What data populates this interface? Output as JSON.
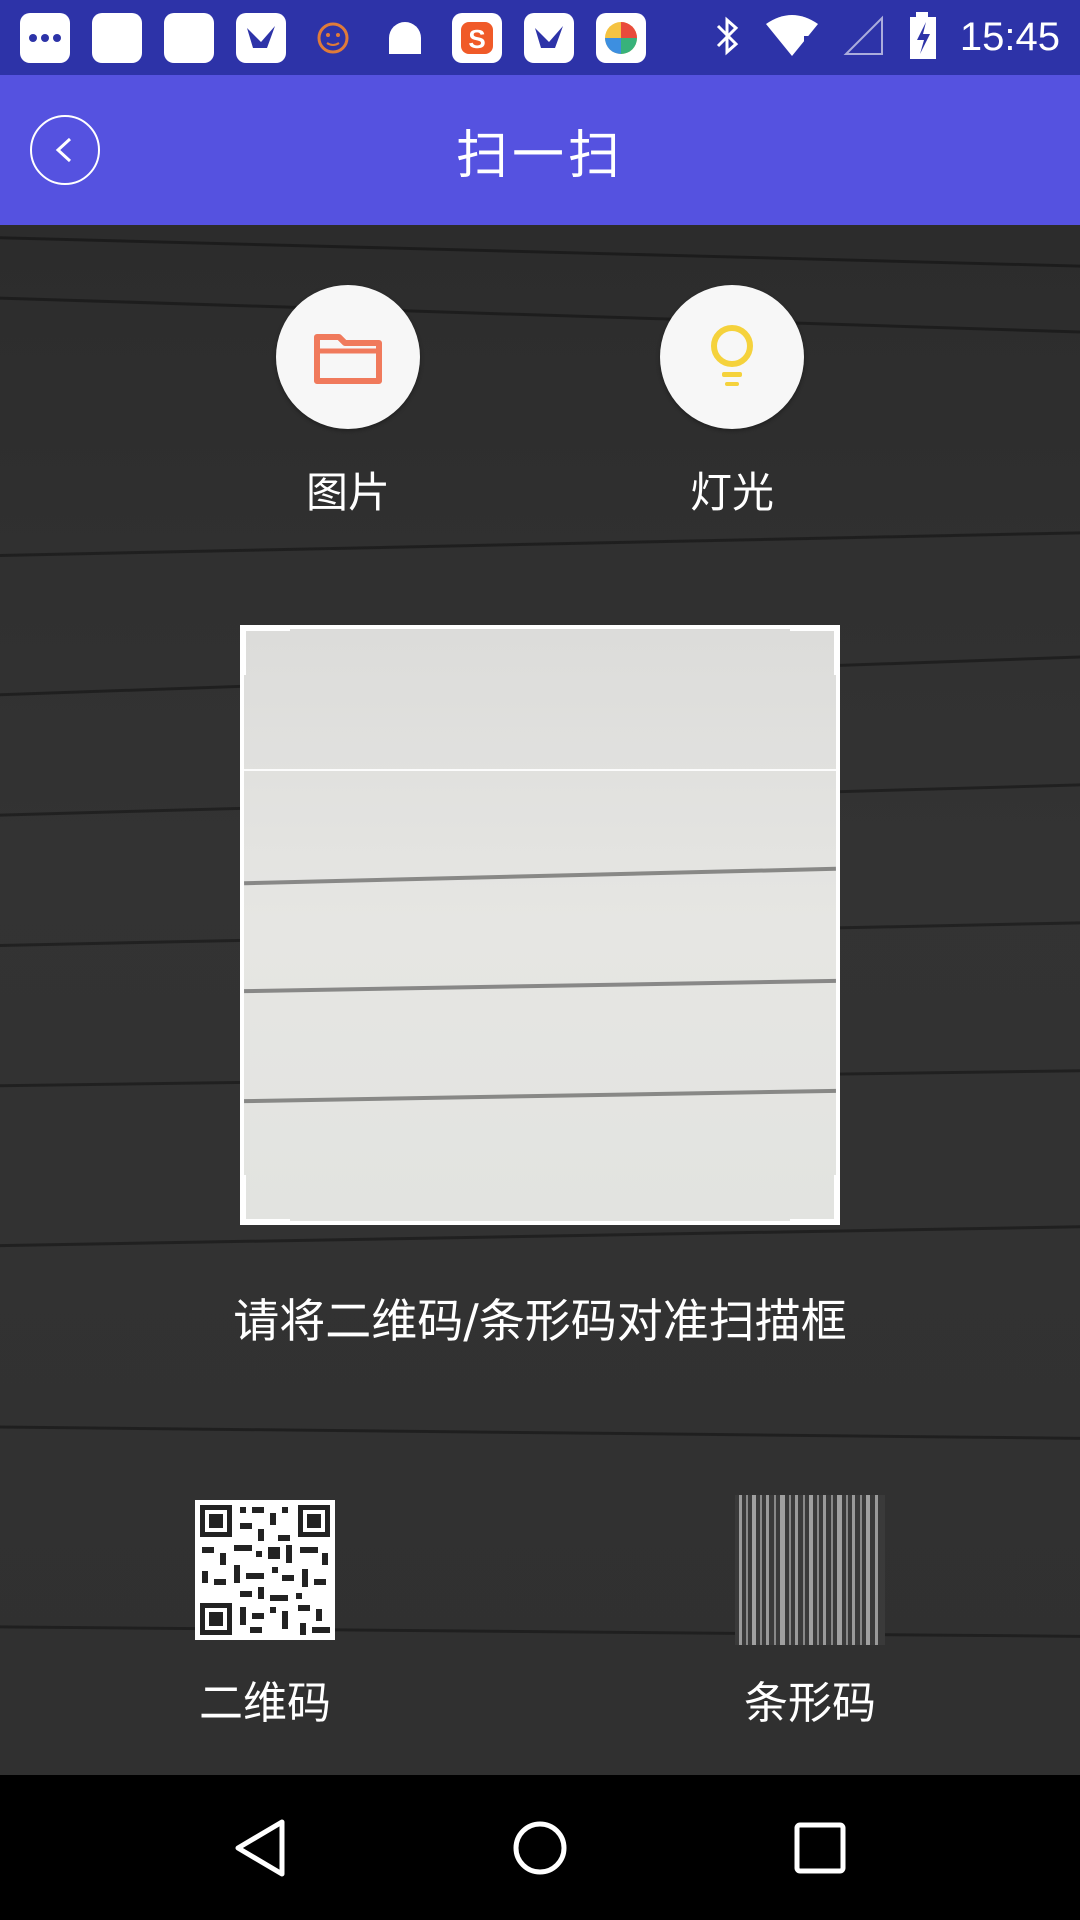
{
  "status_bar": {
    "time": "15:45",
    "notification_icons": [
      "message-icon",
      "blank-app-icon",
      "blank-app-icon",
      "app-bird-icon",
      "face-icon",
      "android-icon",
      "sogou-s-icon",
      "app-bird-icon",
      "color-ball-icon"
    ],
    "right_icons": [
      "bluetooth-icon",
      "wifi-icon",
      "signal-icon",
      "battery-charging-icon"
    ]
  },
  "header": {
    "title": "扫一扫",
    "color": "#5552e0"
  },
  "actions": {
    "picture_label": "图片",
    "light_label": "灯光"
  },
  "scanner": {
    "hint": "请将二维码/条形码对准扫描框"
  },
  "code_types": {
    "qr_label": "二维码",
    "barcode_label": "条形码"
  }
}
